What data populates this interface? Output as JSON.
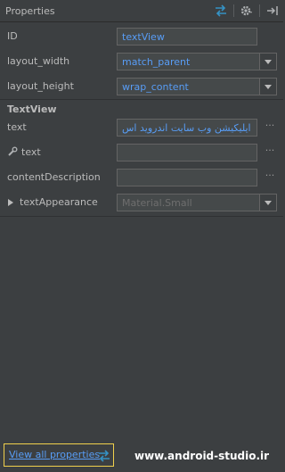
{
  "panel": {
    "title": "Properties",
    "icons": [
      "swap-arrows-icon",
      "gear-icon",
      "collapse-icon"
    ]
  },
  "rows": {
    "id": {
      "label": "ID",
      "value": "textView"
    },
    "layout_width": {
      "label": "layout_width",
      "value": "match_parent"
    },
    "layout_height": {
      "label": "layout_height",
      "value": "wrap_content"
    }
  },
  "section": {
    "title": "TextView"
  },
  "textview": {
    "text": {
      "label": "text",
      "value": "ایلیکیشن وب سایت اندروید اس",
      "button": "···"
    },
    "tools_text": {
      "label": "text",
      "value": "",
      "button": "···"
    },
    "content_description": {
      "label": "contentDescription",
      "value": "",
      "button": "···"
    },
    "text_appearance": {
      "label": "textAppearance",
      "value": "Material.Small"
    }
  },
  "footer": {
    "link_label": "View all properties"
  },
  "watermark": "www.android-studio.ir",
  "colors": {
    "background": "#3c3f41",
    "link": "#589df6",
    "highlight_border": "#f0d04c"
  }
}
